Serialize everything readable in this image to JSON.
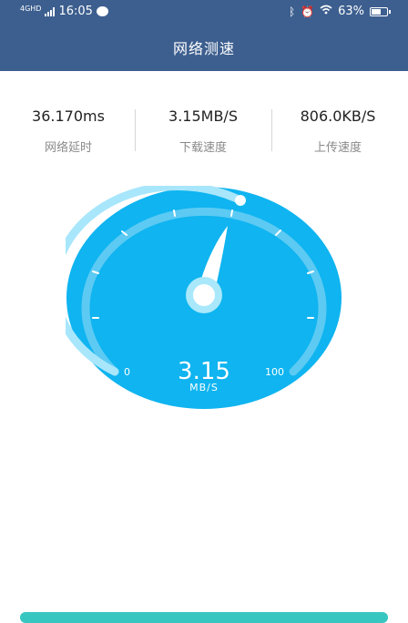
{
  "status_bar": {
    "network": "4GHD",
    "time": "16:05",
    "battery": "63%"
  },
  "header": {
    "title": "网络测速"
  },
  "stats": [
    {
      "value": "36.170ms",
      "label": "网络延时"
    },
    {
      "value": "3.15MB/S",
      "label": "下载速度"
    },
    {
      "value": "806.0KB/S",
      "label": "上传速度"
    }
  ],
  "gauge": {
    "value": "3.15",
    "unit": "MB/S",
    "min_label": "0",
    "max_label": "100",
    "colors": {
      "face": "#0fb4f0",
      "track": "#7fd9f6",
      "needle": "#ffffff"
    }
  },
  "colors": {
    "header": "#3d5f8f",
    "bottom_button": "#38c6c0"
  }
}
